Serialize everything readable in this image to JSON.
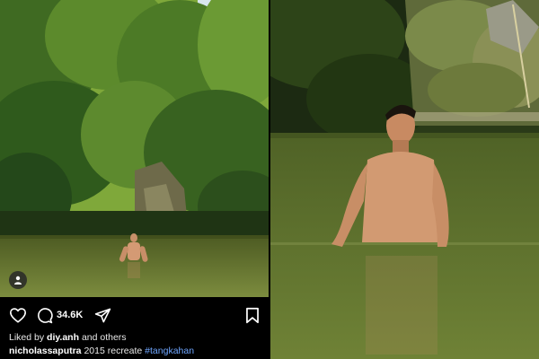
{
  "post": {
    "comment_count": "34.6K",
    "liked_by_prefix": "Liked by",
    "liked_by_user": "diy.anh",
    "liked_by_suffix": "and others",
    "caption_user": "nicholassaputra",
    "caption_text": "2015 recreate",
    "caption_hashtag": "#tangkahan"
  },
  "icons": {
    "like": "heart-icon",
    "comment": "comment-icon",
    "share": "send-icon",
    "save": "bookmark-icon",
    "tag": "user-tag-icon"
  },
  "colors": {
    "background": "#000000",
    "text": "#ffffff",
    "hashtag": "#6fa6ff",
    "forest_dark": "#2b4a1f",
    "river": "#7a8a3a"
  }
}
